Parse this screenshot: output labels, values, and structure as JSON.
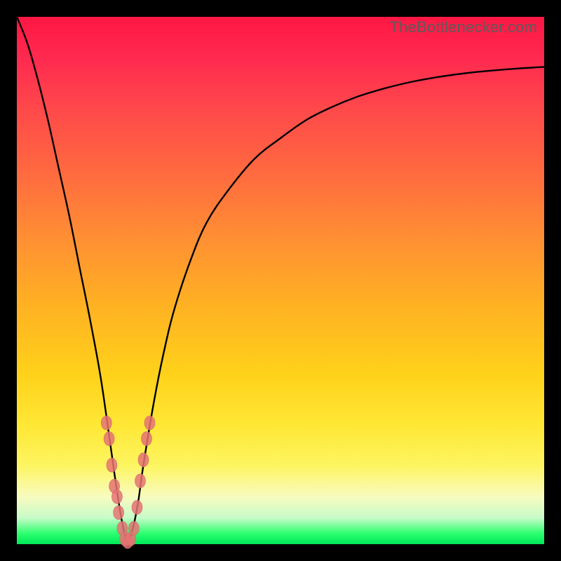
{
  "attribution": "TheBottlenecker.com",
  "colors": {
    "dot": "#e57373",
    "curve": "#000000",
    "gradient_stops": [
      "#ff1744",
      "#ff2a4f",
      "#ff4a4a",
      "#ff6b3f",
      "#ff8f33",
      "#ffb222",
      "#ffd21a",
      "#ffe838",
      "#fdf560",
      "#f8fbbf",
      "#c8fbc8",
      "#2bff6f",
      "#00e85a"
    ]
  },
  "chart_data": {
    "type": "line",
    "title": "",
    "xlabel": "",
    "ylabel": "",
    "xlim": [
      0,
      100
    ],
    "ylim": [
      0,
      100
    ],
    "grid": false,
    "legend": false,
    "series": [
      {
        "name": "bottleneck-curve",
        "x": [
          0,
          2,
          4,
          6,
          8,
          10,
          12,
          14,
          16,
          18,
          19,
          20,
          21,
          22,
          23,
          24,
          26,
          28,
          30,
          33,
          36,
          40,
          45,
          50,
          55,
          60,
          65,
          70,
          75,
          80,
          85,
          90,
          95,
          100
        ],
        "y": [
          100,
          95,
          88,
          80,
          71,
          62,
          52,
          42,
          31,
          17,
          10,
          4,
          0.5,
          3,
          8,
          15,
          27,
          37,
          45,
          54,
          61,
          67,
          73,
          77,
          80.5,
          83,
          85,
          86.5,
          87.7,
          88.6,
          89.3,
          89.8,
          90.2,
          90.5
        ]
      }
    ],
    "scatter": {
      "name": "sample-dots",
      "points": [
        {
          "x": 17.0,
          "y": 23
        },
        {
          "x": 17.5,
          "y": 20
        },
        {
          "x": 18.0,
          "y": 15
        },
        {
          "x": 18.5,
          "y": 11
        },
        {
          "x": 19.0,
          "y": 9
        },
        {
          "x": 19.3,
          "y": 6
        },
        {
          "x": 20.0,
          "y": 3
        },
        {
          "x": 20.5,
          "y": 1
        },
        {
          "x": 21.0,
          "y": 0.5
        },
        {
          "x": 21.6,
          "y": 1
        },
        {
          "x": 22.2,
          "y": 3
        },
        {
          "x": 22.8,
          "y": 7
        },
        {
          "x": 23.4,
          "y": 12
        },
        {
          "x": 24.0,
          "y": 16
        },
        {
          "x": 24.6,
          "y": 20
        },
        {
          "x": 25.2,
          "y": 23
        }
      ]
    }
  }
}
